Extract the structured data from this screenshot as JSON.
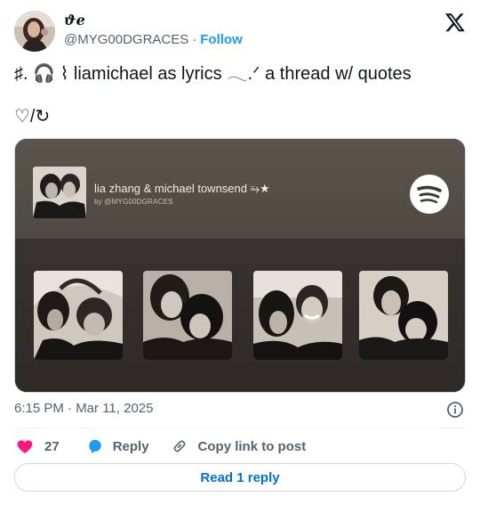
{
  "author": {
    "display_name": "ϑe",
    "handle": "@MYG00DGRACES",
    "separator": "·",
    "follow_label": "Follow"
  },
  "tweet": {
    "text": "♯. 🎧 ⌇ liamichael as lyrics 𓂃.ᐟ a thread w/ quotes",
    "text2": "♡/↻"
  },
  "media": {
    "playlist_title": "lia zhang & michael townsend ⥱★",
    "playlist_by": "by @MYG00DGRACES"
  },
  "meta": {
    "timestamp": "6:15 PM · Mar 11, 2025"
  },
  "actions": {
    "like_count": "27",
    "reply_label": "Reply",
    "copy_label": "Copy link to post"
  },
  "read_reply_label": "Read 1 reply",
  "colors": {
    "like": "#f91880",
    "reply": "#1d9bf0",
    "link": "#006fd6",
    "follow": "#1d9bf0"
  }
}
